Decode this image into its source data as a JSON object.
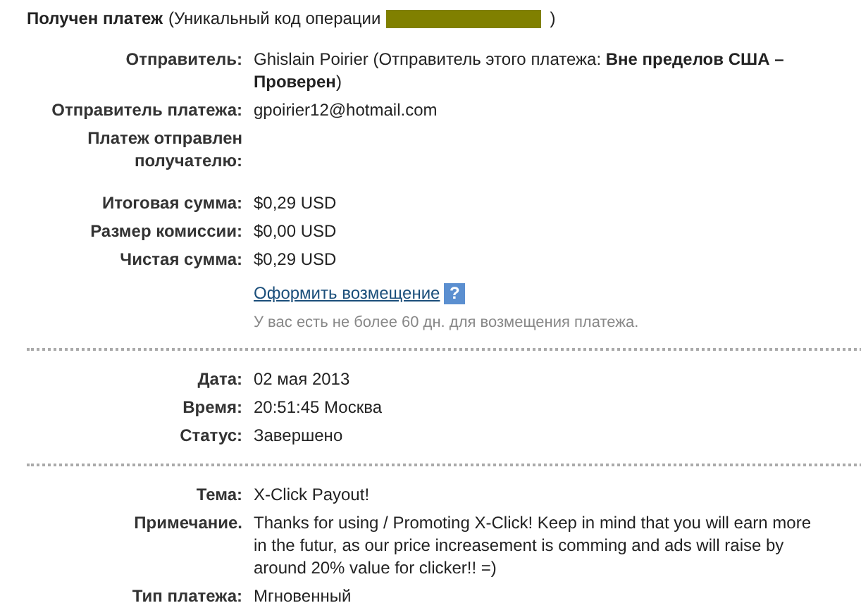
{
  "header": {
    "title": "Получен платеж",
    "code_label": "(Уникальный код операции",
    "code_redacted": true,
    "code_tail": ")"
  },
  "sections": [
    {
      "items": [
        {
          "kind": "row",
          "label": "Отправитель:",
          "value": "Ghislain Poirier (Отправитель этого платежа: **Вне пределов США – Проверен**)"
        },
        {
          "kind": "row",
          "label": "Отправитель платежа:",
          "value": "gpoirier12@hotmail.com"
        },
        {
          "kind": "row",
          "label": "Платеж отправлен получателю:",
          "value": ""
        },
        {
          "kind": "row",
          "label": "Итоговая сумма:",
          "value": "$0,29 USD"
        },
        {
          "kind": "row",
          "label": "Размер комиссии:",
          "value": "$0,00 USD"
        },
        {
          "kind": "row",
          "label": "Чистая сумма:",
          "value": "$0,29 USD"
        },
        {
          "kind": "link",
          "value": "Оформить возмещение",
          "help": "?"
        },
        {
          "kind": "hint",
          "value": "У вас есть не более 60 дн. для возмещения платежа."
        }
      ]
    },
    {
      "items": [
        {
          "kind": "row",
          "label": "Дата:",
          "value": "02 мая 2013"
        },
        {
          "kind": "row",
          "label": "Время:",
          "value": "20:51:45 Москва"
        },
        {
          "kind": "row",
          "label": "Статус:",
          "value": "Завершено"
        }
      ]
    },
    {
      "items": [
        {
          "kind": "row",
          "label": "Тема:",
          "value": "X-Click Payout!"
        },
        {
          "kind": "row",
          "label": "Примечание.",
          "value": "Thanks for using / Promoting X-Click! Keep in mind that you will earn more in the futur, as our price increasement is comming and ads will raise by around 20% value for clicker!! =)"
        },
        {
          "kind": "row",
          "label": "Тип платежа:",
          "value": "Мгновенный"
        }
      ]
    }
  ]
}
